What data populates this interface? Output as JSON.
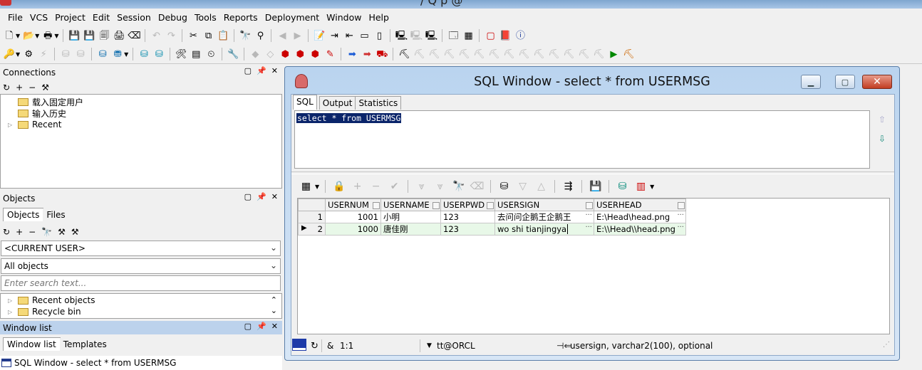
{
  "app": {
    "title": "/  Q  p   @"
  },
  "menu": [
    "File",
    "VCS",
    "Project",
    "Edit",
    "Session",
    "Debug",
    "Tools",
    "Reports",
    "Deployment",
    "Window",
    "Help"
  ],
  "toolbar1": [
    "new-icon",
    "open-icon",
    "print-icon",
    "save-icon",
    "save-as-icon",
    "save-all-icon",
    "print-preview-icon",
    "clear-icon",
    "undo-icon",
    "redo-icon",
    "cut-icon",
    "copy-icon",
    "paste-icon",
    "find-icon",
    "find-next-icon",
    "goto-back-icon",
    "goto-forward-icon",
    "execute-script-icon",
    "indent-icon",
    "unindent-icon",
    "comment-icon",
    "uncomment-icon",
    "explain-icon",
    "compile-icon",
    "describe-icon",
    "window-list-icon",
    "tile-icon",
    "oracle-icon",
    "pdf-icon",
    "info-icon"
  ],
  "toolbar2": [
    "key-icon",
    "gear-icon",
    "wand-icon",
    "db-disabled-icon",
    "db-disabled-icon2",
    "db-sql-icon",
    "db-sql-dropdown-icon",
    "db-plus-icon",
    "db-minus-icon",
    "tools-icon",
    "table-icon",
    "clock-icon",
    "wrench-icon",
    "bookmark-icon",
    "eraser-icon",
    "record-icon",
    "record-plus-icon",
    "record-minus-icon",
    "record-edit-icon",
    "arrow-right-icon",
    "arrow-right2-icon",
    "truck-icon",
    "session-icons"
  ],
  "connections": {
    "header": "Connections",
    "items": [
      {
        "label": "载入固定用户",
        "expandable": false
      },
      {
        "label": "输入历史",
        "expandable": false
      },
      {
        "label": "Recent",
        "expandable": true
      }
    ]
  },
  "objects": {
    "header": "Objects",
    "tabs": [
      "Objects",
      "Files"
    ],
    "user_combo": "<CURRENT USER>",
    "filter_combo": "All objects",
    "search_placeholder": "Enter search text...",
    "items": [
      "Recent objects",
      "Recycle bin"
    ]
  },
  "window_list": {
    "header": "Window list",
    "tabs": [
      "Window list",
      "Templates"
    ],
    "items": [
      "SQL Window - select * from USERMSG"
    ]
  },
  "sql_window": {
    "title": "SQL Window - select * from USERMSG",
    "tabs": [
      "SQL",
      "Output",
      "Statistics"
    ],
    "sql_text": "select * from USERMSG",
    "columns": [
      "USERNUM",
      "USERNAME",
      "USERPWD",
      "USERSIGN",
      "USERHEAD"
    ],
    "rows": [
      {
        "rownum": "1",
        "cells": [
          "1001",
          "小明",
          "123",
          "去问问企鹅王企鹅王",
          "E:\\Head\\head.png"
        ]
      },
      {
        "rownum": "2",
        "cells": [
          "1000",
          "唐佳刚",
          "123",
          "wo shi tianjingya",
          "E:\\\\Head\\\\head.png"
        ]
      }
    ],
    "status": {
      "amp": "&",
      "position": "1:1",
      "connection": "tt@ORCL",
      "field_info": "usersign, varchar2(100), optional"
    }
  },
  "colors": {
    "accent": "#0a246a",
    "current_row": "#e8f8e8",
    "close_button": "#c23d22",
    "window_frame": "#bad4ef"
  }
}
